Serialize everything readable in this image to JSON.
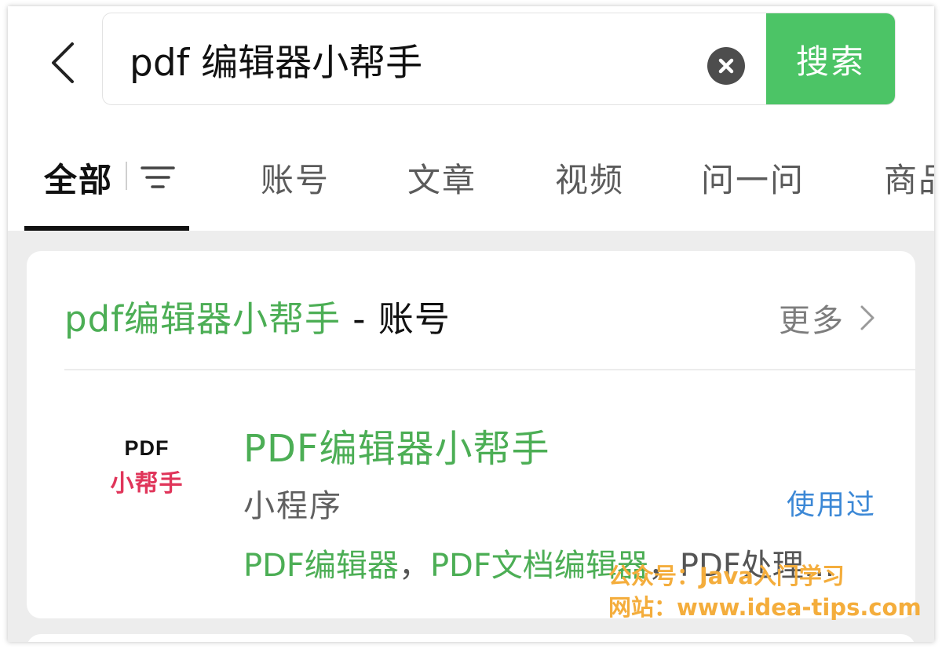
{
  "search": {
    "query": "pdf 编辑器小帮手",
    "submit_label": "搜索"
  },
  "tabs": [
    {
      "label": "全部",
      "active": true
    },
    {
      "label": "账号",
      "active": false
    },
    {
      "label": "文章",
      "active": false
    },
    {
      "label": "视频",
      "active": false
    },
    {
      "label": "问一问",
      "active": false
    },
    {
      "label": "商品",
      "active": false
    }
  ],
  "result_section": {
    "title_keyword": "pdf编辑器小帮手",
    "title_suffix": " - 账号",
    "more_label": "更多"
  },
  "result_item": {
    "logo_line1": "PDF",
    "logo_line2": "小帮手",
    "name": "PDF编辑器小帮手",
    "type": "小程序",
    "badge": "使用过",
    "tag1": "PDF编辑器",
    "tag_sep": "，",
    "tag2": "PDF文档编辑器",
    "tag3": "PDF处理…"
  },
  "watermark": {
    "line1": "公众号：Java入门学习",
    "line2": "网站：www.idea-tips.com"
  },
  "icons": {
    "back": "chevron-left-icon",
    "clear": "clear-circle-icon",
    "filter": "filter-icon",
    "more": "chevron-right-icon"
  },
  "colors": {
    "accent_green": "#4cc466",
    "keyword_green": "#4cae55",
    "badge_blue": "#3c88d6",
    "logo_red": "#e0355a",
    "watermark_orange": "#f4ad3c"
  }
}
